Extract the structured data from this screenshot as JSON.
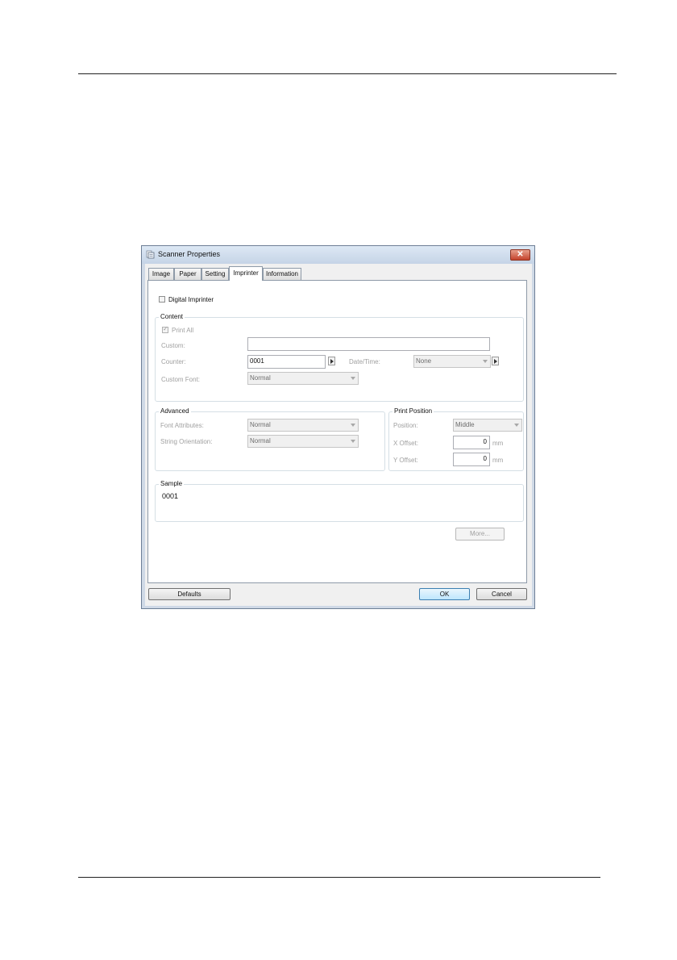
{
  "window": {
    "title": "Scanner Properties",
    "close_glyph": "✕"
  },
  "tabs": [
    {
      "label": "Image"
    },
    {
      "label": "Paper"
    },
    {
      "label": "Setting"
    },
    {
      "label": "Imprinter",
      "active": true
    },
    {
      "label": "Information"
    }
  ],
  "digital_imprinter": {
    "label": "Digital Imprinter",
    "checked": false
  },
  "content": {
    "title": "Content",
    "print_all": {
      "label": "Print All",
      "checked": true
    },
    "custom": {
      "label": "Custom:",
      "value": ""
    },
    "counter": {
      "label": "Counter:",
      "value": "0001"
    },
    "date_time": {
      "label": "Date/Time:",
      "value": "None"
    },
    "custom_font": {
      "label": "Custom Font:",
      "value": "Normal"
    }
  },
  "advanced": {
    "title": "Advanced",
    "font_attributes": {
      "label": "Font Attributes:",
      "value": "Normal"
    },
    "string_orientation": {
      "label": "String Orientation:",
      "value": "Normal"
    }
  },
  "print_position": {
    "title": "Print Position",
    "position": {
      "label": "Position:",
      "value": "Middle"
    },
    "x_offset": {
      "label": "X Offset:",
      "value": "0",
      "unit": "mm"
    },
    "y_offset": {
      "label": "Y Offset:",
      "value": "0",
      "unit": "mm"
    }
  },
  "sample": {
    "title": "Sample",
    "text": "0001"
  },
  "buttons": {
    "more": "More...",
    "defaults": "Defaults",
    "ok": "OK",
    "cancel": "Cancel"
  }
}
